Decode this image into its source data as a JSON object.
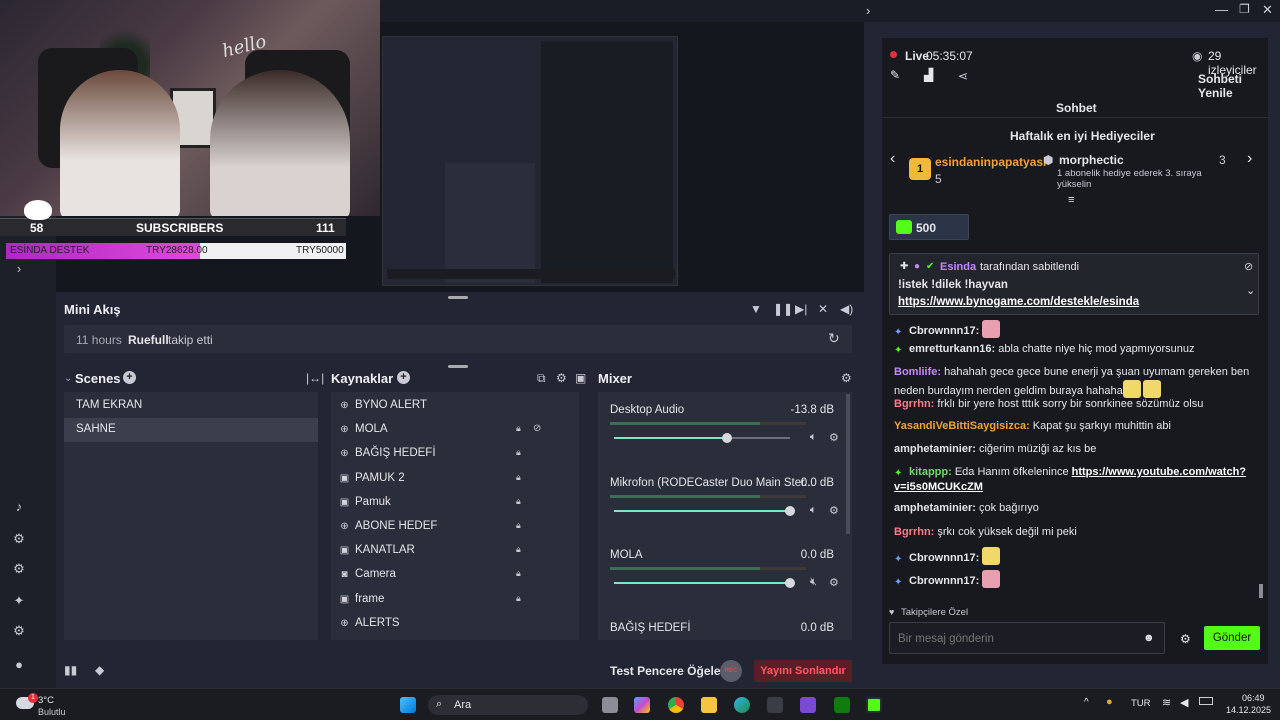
{
  "preview": {
    "subscribers_count": "58",
    "subscribers_label": "SUBSCRIBERS",
    "subscribers_goal": "111",
    "donation_label": "ESİNDA DESTEK",
    "donation_current": "TRY28628.00",
    "donation_goal": "TRY50000",
    "donation_progress": 0.57,
    "cam_text": "hello"
  },
  "activity": {
    "title": "Mini Akış",
    "time": "11 hours",
    "user": "Ruefull",
    "action": "takip etti"
  },
  "scenes": {
    "title": "Scenes",
    "items": [
      "TAM EKRAN",
      "SAHNE"
    ],
    "active_index": 1
  },
  "sources": {
    "title": "Kaynaklar",
    "items": [
      {
        "label": "BYNO ALERT",
        "icon": "globe-icon",
        "locked": false
      },
      {
        "label": "MOLA",
        "icon": "globe-icon",
        "locked": true,
        "hidden": true
      },
      {
        "label": "BAĞIŞ HEDEFİ",
        "icon": "globe-icon",
        "locked": true
      },
      {
        "label": "PAMUK 2",
        "icon": "image-icon",
        "locked": true
      },
      {
        "label": "Pamuk",
        "icon": "image-icon",
        "locked": true
      },
      {
        "label": "ABONE HEDEF",
        "icon": "globe-icon",
        "locked": true
      },
      {
        "label": "KANATLAR",
        "icon": "image-icon",
        "locked": true
      },
      {
        "label": "Camera",
        "icon": "camera-icon",
        "locked": true
      },
      {
        "label": "frame",
        "icon": "image-icon",
        "locked": true
      },
      {
        "label": "ALERTS",
        "icon": "globe-icon",
        "locked": false
      }
    ]
  },
  "mixer": {
    "title": "Mixer",
    "channels": [
      {
        "name": "Desktop Audio",
        "db": "-13.8 dB",
        "volume": 0.64,
        "muted": false
      },
      {
        "name": "Mikrofon (RODECaster Duo Main Ster...",
        "db": "0.0 dB",
        "volume": 1.0,
        "muted": false
      },
      {
        "name": "MOLA",
        "db": "0.0 dB",
        "volume": 1.0,
        "muted": true
      },
      {
        "name": "BAĞIŞ HEDEFİ",
        "db": "0.0 dB",
        "volume": 1.0,
        "muted": false
      }
    ]
  },
  "footer": {
    "test_label": "Test Pencere Öğeleri",
    "rec_label": "REC",
    "end_stream_label": "Yayını Sonlandır"
  },
  "chat": {
    "live_label": "Live",
    "live_time": "05:35:07",
    "viewers": "29 izleyiciler",
    "refresh_label": "Sohbeti Yenile",
    "title": "Sohbet",
    "top_gifters_title": "Haftalık en iyi Hediyeciler",
    "gifter1_name": "esindaninpapatyasi",
    "gifter1_count": "5",
    "gifter1_rank": "1",
    "gifter2_name": "morphectic",
    "gifter2_count": "3",
    "gifter2_note": "1 abonelik hediye ederek 3. sıraya yükselin",
    "goal_value": "500",
    "pinned_by_user": "Esinda",
    "pinned_by_suffix": "tarafından sabitlendi",
    "pinned_text": "!istek !dilek !hayvan",
    "pinned_link": "https://www.bynogame.com/destekle/esinda",
    "messages": [
      {
        "user": "Cbrownnn17:",
        "color": "#e6e6ea",
        "text": ""
      },
      {
        "user": "emretturkann16:",
        "color": "#e6e6ea",
        "text": "abla chatte niye hiç mod yapmıyorsunuz"
      },
      {
        "user": "Bomliife:",
        "color": "#c58af9",
        "text": "hahahah gece gece bune enerji ya şuan uyumam gereken ben neden burdayım nerden geldim buraya hahaha"
      },
      {
        "user": "Bgrrhn:",
        "color": "#ff7a8a",
        "text": "frklı bir yere host tttık sorry bir sonrkinee sözümüz olsu"
      },
      {
        "user": "YasandiVeBittiSaygisizca:",
        "color": "#f2a13b",
        "text": "Kapat şu şarkıyı muhittin abi"
      },
      {
        "user": "amphetaminier:",
        "color": "#e6e6ea",
        "text": "ciğerim müziği az kıs be"
      },
      {
        "user": "kitappp:",
        "color": "#6fd86b",
        "text": "Eda Hanım öfkelenince",
        "link": "https://www.youtube.com/watch?v=i5s0MCUKcZM"
      },
      {
        "user": "amphetaminier:",
        "color": "#e6e6ea",
        "text": "çok bağırıyo"
      },
      {
        "user": "Bgrrhn:",
        "color": "#ff7a8a",
        "text": "şrkı cok yüksek değil mi peki"
      },
      {
        "user": "Cbrownnn17:",
        "color": "#e6e6ea",
        "text": ""
      },
      {
        "user": "Cbrownnn17:",
        "color": "#e6e6ea",
        "text": ""
      }
    ],
    "followers_only": "Takipçilere Özel",
    "input_placeholder": "Bir mesaj gönderin",
    "send_label": "Gönder"
  },
  "taskbar": {
    "weather_temp": "3°C",
    "weather_desc": "Bulutlu",
    "weather_badge": "1",
    "search_label": "Ara",
    "lang": "TUR",
    "time": "06:49",
    "date": "14.12.2025"
  },
  "colors": {
    "accent_green": "#53fc18",
    "end_red": "#e0303a",
    "meter_green": "#7fe6c4",
    "donation_pink": "#d23bd8"
  }
}
